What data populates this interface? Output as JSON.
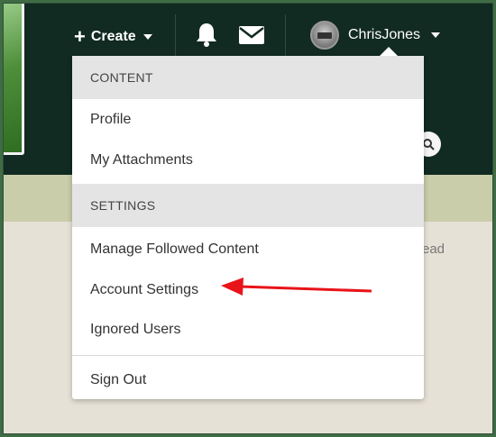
{
  "header": {
    "create_label": "Create",
    "username": "ChrisJones",
    "icons": [
      "plus-icon",
      "caret-down-icon",
      "bell-icon",
      "envelope-icon",
      "search-icon"
    ]
  },
  "background": {
    "partial_text": "ead"
  },
  "menu": {
    "sections": [
      {
        "header": "CONTENT",
        "items": [
          "Profile",
          "My Attachments"
        ]
      },
      {
        "header": "SETTINGS",
        "items": [
          "Manage Followed Content",
          "Account Settings",
          "Ignored Users"
        ]
      }
    ],
    "footer_item": "Sign Out",
    "highlighted_item": "Account Settings"
  },
  "colors": {
    "header_bg": "#112a22",
    "frame_green": "#3f6b45",
    "annotation_arrow": "#e8141a"
  }
}
